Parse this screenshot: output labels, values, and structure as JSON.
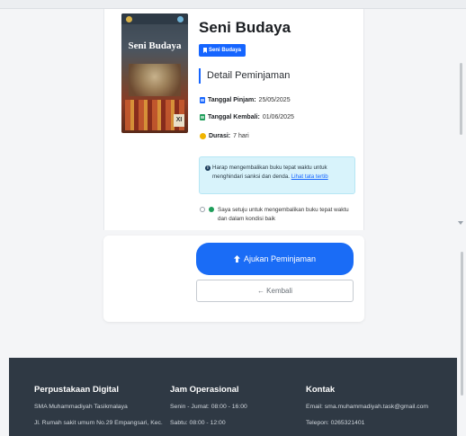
{
  "book": {
    "title": "Seni Budaya",
    "badge": "Seni Budaya",
    "cover_title": "Seni Budaya",
    "cover_grade": "XI"
  },
  "details": {
    "heading": "Detail Peminjaman",
    "borrow_label": "Tanggal Pinjam:",
    "borrow_date": "25/05/2025",
    "return_label": "Tanggal Kembali:",
    "return_date": "01/06/2025",
    "duration_label": "Durasi:",
    "duration_value": "7 hari"
  },
  "alert": {
    "text": "Harap mengembalikan buku tepat waktu untuk menghindari sanksi dan denda.",
    "link": "Lihat tata tertib"
  },
  "agreement": {
    "text": "Saya setuju untuk mengembalikan buku tepat waktu dan dalam kondisi baik"
  },
  "actions": {
    "submit": "Ajukan Peminjaman",
    "back": "← Kembali"
  },
  "footer": {
    "col1": {
      "title": "Perpustakaan Digital",
      "line1": "SMA Muhammadiyah Tasikmalaya",
      "line2": "Jl. Rumah sakit umum No.29 Empangsari, Kec."
    },
    "col2": {
      "title": "Jam Operasional",
      "line1": "Senin - Jumat: 08:00 - 16:00",
      "line2": "Sabtu: 08:00 - 12:00"
    },
    "col3": {
      "title": "Kontak",
      "line1": "Email: sma.muhammadiyah.task@gmail.com",
      "line2": "Telepon: 0265321401"
    }
  },
  "colors": {
    "primary": "#1a6cf6",
    "footer_bg": "#2f3944",
    "alert_bg": "#d8f3fb",
    "success": "#1e9e5a"
  }
}
